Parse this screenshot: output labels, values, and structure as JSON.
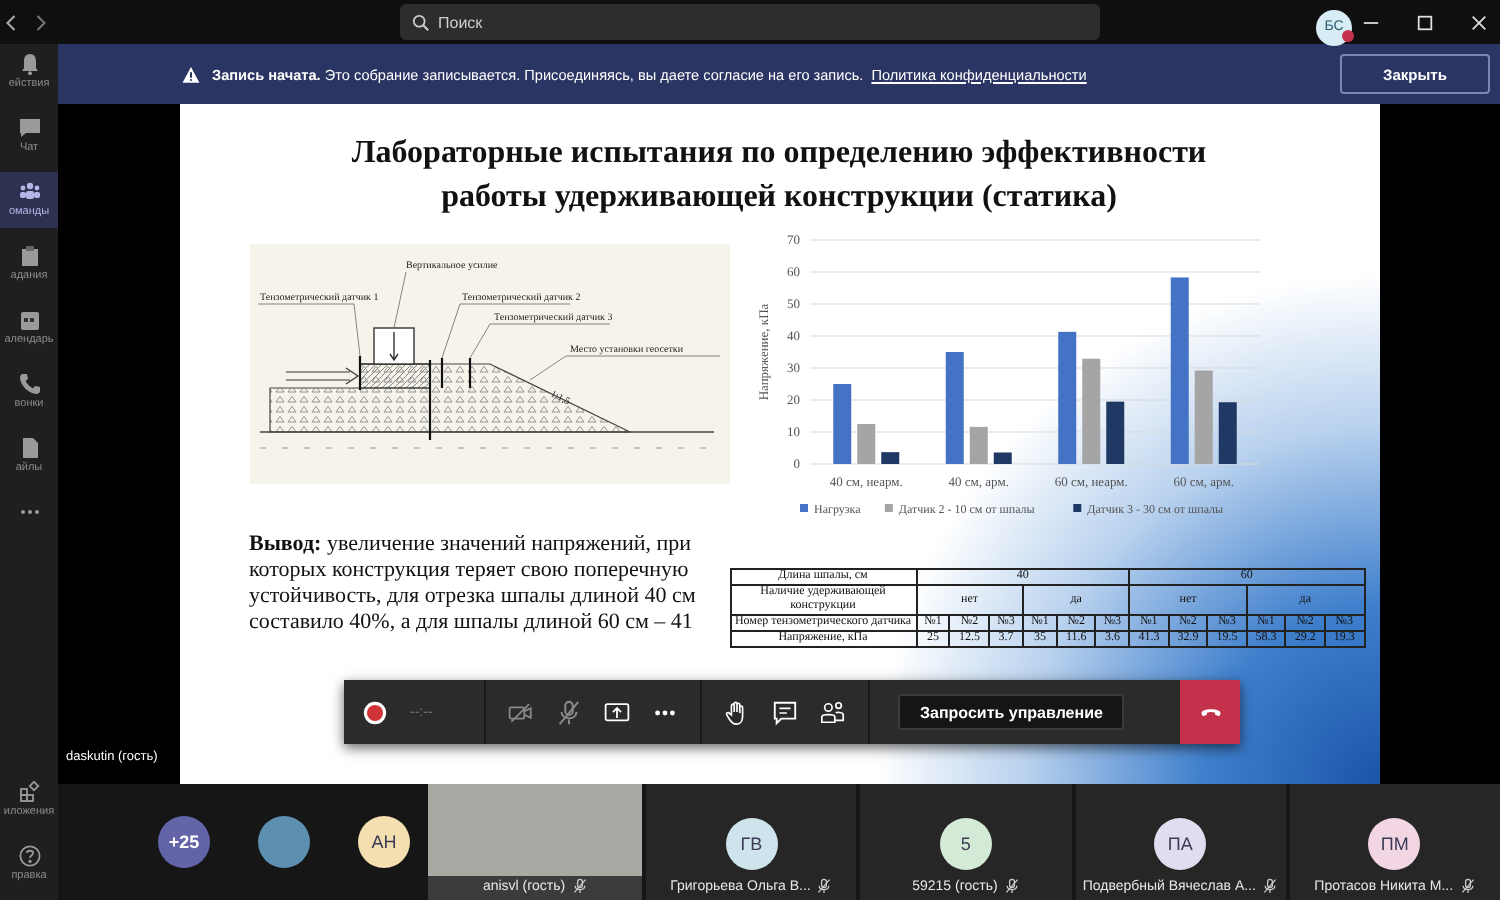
{
  "top_bar": {
    "search": {
      "placeholder": "Поиск"
    },
    "account": {
      "initials": "БС"
    }
  },
  "sidebar": {
    "items": [
      {
        "label": "ействия",
        "kind": "bell",
        "selected": false
      },
      {
        "label": "Чат",
        "kind": "chat",
        "selected": false
      },
      {
        "label": "оманды",
        "kind": "teams",
        "selected": true
      },
      {
        "label": "адания",
        "kind": "bag",
        "selected": false
      },
      {
        "label": "алендарь",
        "kind": "calendar",
        "selected": false
      },
      {
        "label": "вонки",
        "kind": "phone",
        "selected": false
      },
      {
        "label": "айлы",
        "kind": "file",
        "selected": false
      },
      {
        "kind": "more",
        "selected": false
      }
    ],
    "bottom_items": [
      {
        "label": "иложения",
        "kind": "apps",
        "selected": false
      },
      {
        "label": "правка",
        "kind": "help",
        "selected": false
      }
    ]
  },
  "banner": {
    "message": "**Запись начата.** Это собрание записывается. Присоединяясь, вы даете согласие на его запись.",
    "link": "Политика конфиденциальности",
    "button": "Закрыть"
  },
  "slide": {
    "title": "Лабораторные испытания по определению эффективности работы удерживающей конструкции (статика)",
    "diagram": {
      "labels": [
        "Тензометрический датчик 1",
        "Вертикальное усилие",
        "Тензометрический датчик 2",
        "Тензометрический датчик 3",
        "Место установки геосетки",
        "1:1,5"
      ]
    },
    "chart_data": {
      "type": "bar",
      "ylabel": "Напряжение, кПа",
      "categories": [
        "40 см, неарм.",
        "40 см, арм.",
        "60 см, неарм.",
        "60 см, арм."
      ],
      "series": [
        {
          "name": "Нагрузка",
          "color": "#4472c4",
          "values": [
            25,
            35,
            41.3,
            58.3
          ]
        },
        {
          "name": "Датчик 2 - 10 см от шпалы",
          "color": "#a5a5a5",
          "values": [
            12.5,
            11.6,
            32.9,
            29.2
          ]
        },
        {
          "name": "Датчик 3 - 30 см от шпалы",
          "color": "#203864",
          "values": [
            3.7,
            3.6,
            19.5,
            19.3
          ]
        }
      ],
      "ylim": [
        0,
        70
      ],
      "yticks": [
        0,
        10,
        20,
        30,
        40,
        50,
        60,
        70
      ],
      "grid": true,
      "legend": true
    },
    "conclusion": "**Вывод:** увеличение значений напряжений, при которых конструкция теряет свою поперечную устойчивость, для отрезка шпалы длиной 40 см составило 40%, а для шпалы длиной 60 см – 41",
    "table": {
      "row_labels": [
        "Длина шпалы, см",
        "Наличие удерживающей конструкции",
        "Номер тензометрического датчика",
        "Напряжение, кПа"
      ],
      "groups": [
        {
          "length": "40",
          "variants": [
            {
              "presence": "нет",
              "sensors": [
                "№1",
                "№2",
                "№3"
              ],
              "values": [
                "25",
                "12.5",
                "3.7"
              ]
            },
            {
              "presence": "да",
              "sensors": [
                "№1",
                "№2",
                "№3"
              ],
              "values": [
                "35",
                "11.6",
                "3.6"
              ]
            }
          ]
        },
        {
          "length": "60",
          "variants": [
            {
              "presence": "нет",
              "sensors": [
                "№1",
                "№2",
                "№3"
              ],
              "values": [
                "41.3",
                "32.9",
                "19.5"
              ]
            },
            {
              "presence": "да",
              "sensors": [
                "№1",
                "№2",
                "№3"
              ],
              "values": [
                "58.3",
                "29.2",
                "19.3"
              ]
            }
          ]
        }
      ]
    }
  },
  "toolbar": {
    "timer": "--:--",
    "request_button": "Запросить управление"
  },
  "presenter_label": "daskutin (гость)",
  "participants": {
    "overflow": "+25",
    "avatars": [
      {
        "kind": "photo"
      },
      {
        "kind": "initials",
        "initials": "АН",
        "color": "#f4dfb0"
      }
    ],
    "tiles": [
      {
        "kind": "video",
        "name": "anisvl (гость)",
        "muted": true
      },
      {
        "kind": "initials",
        "initials": "ГВ",
        "color": "#cfe3ec",
        "name": "Григорьева Ольга В...",
        "muted": true
      },
      {
        "kind": "initials",
        "initials": "5",
        "color": "#d3ead6",
        "name": "59215 (гость)",
        "muted": true
      },
      {
        "kind": "initials",
        "initials": "ПА",
        "color": "#e2dcf0",
        "name": "Подвербный Вячеслав А...",
        "muted": true
      },
      {
        "kind": "initials",
        "initials": "ПМ",
        "color": "#f3d6e4",
        "name": "Протасов Никита М...",
        "muted": true
      }
    ]
  }
}
